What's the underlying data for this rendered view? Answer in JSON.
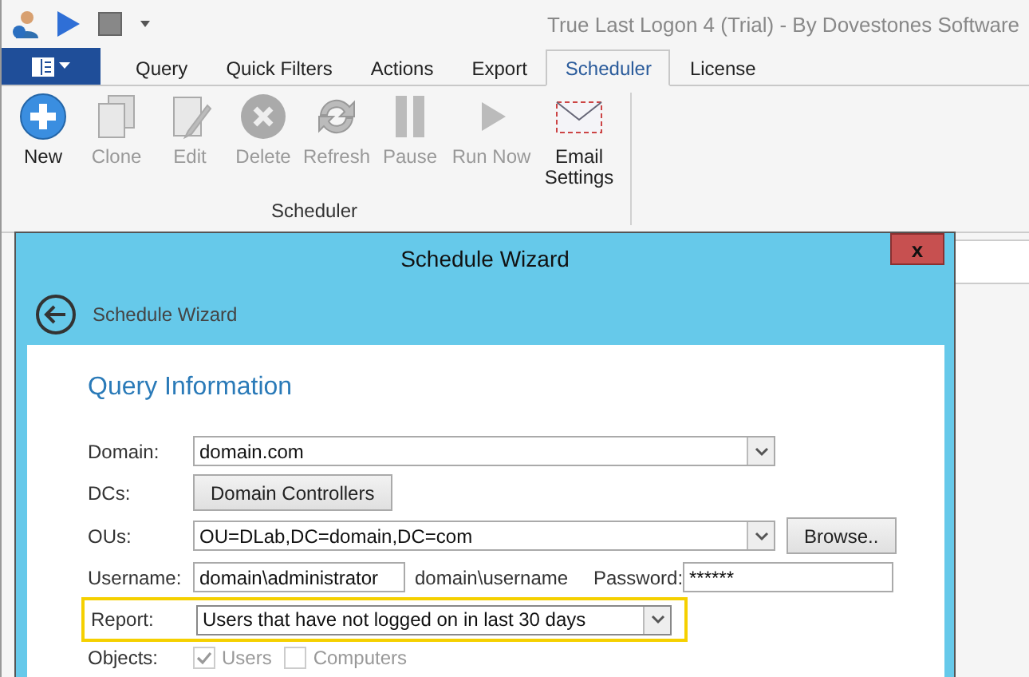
{
  "window": {
    "title": "True Last Logon 4 (Trial) - By Dovestones Software"
  },
  "tabs": [
    {
      "label": "Query",
      "selected": false
    },
    {
      "label": "Quick Filters",
      "selected": false
    },
    {
      "label": "Actions",
      "selected": false
    },
    {
      "label": "Export",
      "selected": false
    },
    {
      "label": "Scheduler",
      "selected": true
    },
    {
      "label": "License",
      "selected": false
    }
  ],
  "ribbon": {
    "group": "Scheduler",
    "buttons": [
      {
        "kind": "new",
        "label": "New",
        "disabled": false
      },
      {
        "kind": "clone",
        "label": "Clone",
        "disabled": true
      },
      {
        "kind": "edit",
        "label": "Edit",
        "disabled": true
      },
      {
        "kind": "delete",
        "label": "Delete",
        "disabled": true
      },
      {
        "kind": "refresh",
        "label": "Refresh",
        "disabled": true
      },
      {
        "kind": "pause",
        "label": "Pause",
        "disabled": true
      },
      {
        "kind": "run",
        "label": "Run Now",
        "disabled": true
      },
      {
        "kind": "email",
        "label": "Email Settings",
        "disabled": false
      }
    ]
  },
  "dialog": {
    "title": "Schedule Wizard",
    "close": "x",
    "header": "Schedule Wizard",
    "section": "Query Information",
    "domain": {
      "label": "Domain:",
      "value": "domain.com"
    },
    "dcs": {
      "label": "DCs:",
      "button": "Domain Controllers"
    },
    "ous": {
      "label": "OUs:",
      "value": "OU=DLab,DC=domain,DC=com",
      "button": "Browse.."
    },
    "username": {
      "label": "Username:",
      "value": "domain\\administrator",
      "hint": "domain\\username"
    },
    "password": {
      "label": "Password:",
      "value": "******"
    },
    "report": {
      "label": "Report:",
      "value": "Users that have not logged on in last 30 days",
      "highlighted": true
    },
    "objects": {
      "label": "Objects:",
      "items": [
        {
          "label": "Users",
          "checked": true,
          "disabled": true
        },
        {
          "label": "Computers",
          "checked": false,
          "disabled": true
        }
      ]
    }
  }
}
